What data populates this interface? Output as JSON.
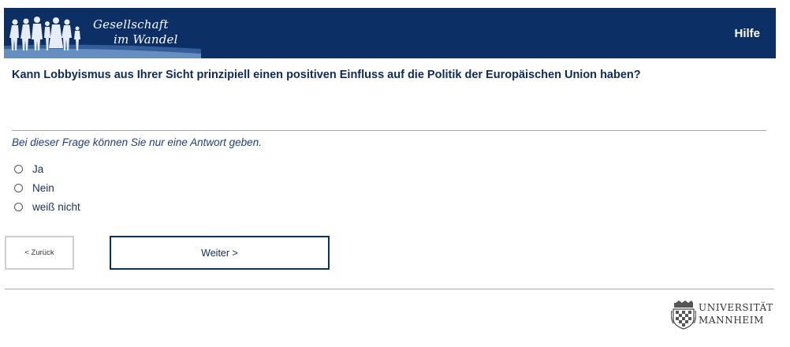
{
  "header": {
    "logo_line1": "Gesellschaft",
    "logo_line2": "im Wandel",
    "help_label": "Hilfe",
    "background_color": "#0c2f66"
  },
  "question": {
    "text": "Kann Lobbyismus aus Ihrer Sicht prinzipiell einen positiven Einfluss auf die Politik der Europäischen Union haben?"
  },
  "instruction": "Bei dieser Frage können Sie nur eine Antwort geben.",
  "options": [
    {
      "label": "Ja",
      "selected": false
    },
    {
      "label": "Nein",
      "selected": false
    },
    {
      "label": "weiß nicht",
      "selected": false
    }
  ],
  "navigation": {
    "back_label": "< Zurück",
    "next_label": "Weiter >"
  },
  "footer": {
    "university_line1": "UNIVERSITÄT",
    "university_line2": "MANNHEIM"
  }
}
